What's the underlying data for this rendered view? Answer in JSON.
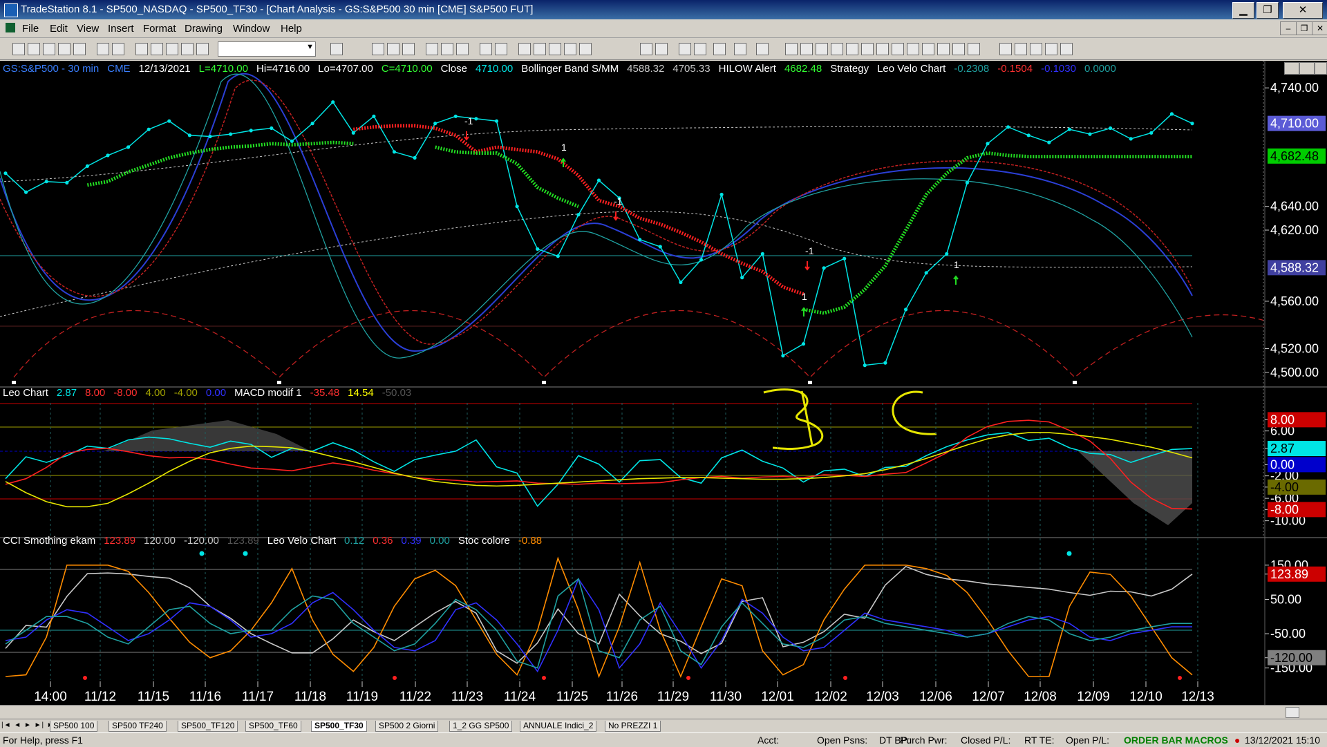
{
  "window": {
    "title": "TradeStation 8.1 - SP500_NASDAQ - SP500_TF30 - [Chart Analysis - GS:S&P500  30 min  [CME] S&P500 FUT]",
    "minimize": "▁",
    "restore": "❐",
    "close": "✕"
  },
  "menu": {
    "items": [
      "File",
      "Edit",
      "View",
      "Insert",
      "Format",
      "Drawing",
      "Window",
      "Help"
    ],
    "mdi": [
      "‒",
      "❐",
      "✕"
    ]
  },
  "header": {
    "segments": [
      {
        "text": "GS:S&P500 - 30 min",
        "color": "#3a7fff"
      },
      {
        "text": "CME",
        "color": "#3a7fff"
      },
      {
        "text": "12/13/2021",
        "color": "#ffffff"
      },
      {
        "text": "L=4710.00",
        "color": "#33ff33"
      },
      {
        "text": "Hi=4716.00",
        "color": "#ffffff"
      },
      {
        "text": "Lo=4707.00",
        "color": "#ffffff"
      },
      {
        "text": "C=4710.00",
        "color": "#33ff33"
      },
      {
        "text": "Close",
        "color": "#ffffff"
      },
      {
        "text": "4710.00",
        "color": "#00e5e5"
      },
      {
        "text": "Bollinger Band S/MM",
        "color": "#ffffff"
      },
      {
        "text": "4588.32",
        "color": "#c8c8c8"
      },
      {
        "text": "4705.33",
        "color": "#c8c8c8"
      },
      {
        "text": "HILOW Alert",
        "color": "#ffffff"
      },
      {
        "text": "4682.48",
        "color": "#33ff33"
      },
      {
        "text": "Strategy",
        "color": "#ffffff"
      },
      {
        "text": "Leo Velo Chart",
        "color": "#ffffff"
      },
      {
        "text": "-0.2308",
        "color": "#1fa0a0"
      },
      {
        "text": "-0.1504",
        "color": "#ff3030"
      },
      {
        "text": "-0.1030",
        "color": "#3030ff"
      },
      {
        "text": "0.0000",
        "color": "#1fa0a0"
      }
    ]
  },
  "panel2_header": {
    "segments": [
      {
        "text": "Leo Chart",
        "color": "#ffffff"
      },
      {
        "text": "2.87",
        "color": "#00e5e5"
      },
      {
        "text": "8.00",
        "color": "#ff3030"
      },
      {
        "text": "-8.00",
        "color": "#ff3030"
      },
      {
        "text": "4.00",
        "color": "#a0a000"
      },
      {
        "text": "-4.00",
        "color": "#a0a000"
      },
      {
        "text": "0.00",
        "color": "#3030ff"
      },
      {
        "text": "MACD modif 1",
        "color": "#ffffff"
      },
      {
        "text": "-35.48",
        "color": "#ff3030"
      },
      {
        "text": "14.54",
        "color": "#ffff00"
      },
      {
        "text": "-50.03",
        "color": "#555555"
      }
    ]
  },
  "panel3_header": {
    "segments": [
      {
        "text": "CCI Smothing ekam",
        "color": "#ffffff"
      },
      {
        "text": "123.89",
        "color": "#ff3030"
      },
      {
        "text": "120.00",
        "color": "#c8c8c8"
      },
      {
        "text": "-120.00",
        "color": "#c8c8c8"
      },
      {
        "text": "123.89",
        "color": "#555555"
      },
      {
        "text": "Leo Velo Chart",
        "color": "#ffffff"
      },
      {
        "text": "0.12",
        "color": "#1fa0a0"
      },
      {
        "text": "0.36",
        "color": "#ff3030"
      },
      {
        "text": "0.39",
        "color": "#3030ff"
      },
      {
        "text": "0.00",
        "color": "#1fa0a0"
      },
      {
        "text": "Stoc colore",
        "color": "#ffffff"
      },
      {
        "text": "-0.88",
        "color": "#ff8c00"
      }
    ]
  },
  "annotations": {
    "hand1": "B",
    "hand2": "C"
  },
  "trade_labels": [
    "-1",
    "1",
    "-1",
    "-1",
    "1",
    "1"
  ],
  "chart_data": [
    {
      "type": "line",
      "title": "GS:S&P500 - 30 min",
      "ylim": [
        4490,
        4750
      ],
      "y_ticks": [
        "4,740.00",
        "4,640.00",
        "4,620.00",
        "4,560.00",
        "4,520.00",
        "4,500.00"
      ],
      "price_tags": [
        {
          "label": "4,710.00",
          "bg": "#5b5bd6",
          "fg": "#ffffff",
          "value": 4710
        },
        {
          "label": "4,682.48",
          "bg": "#00cc00",
          "fg": "#000000",
          "value": 4682.48
        },
        {
          "label": "4,588.32",
          "bg": "#4040a0",
          "fg": "#ffffff",
          "value": 4588.32
        }
      ],
      "x_ticks": [
        "14:00",
        "11/12",
        "11/15",
        "11/16",
        "11/17",
        "11/18",
        "11/19",
        "11/22",
        "11/23",
        "11/24",
        "11/25",
        "11/26",
        "11/29",
        "11/30",
        "12/01",
        "12/02",
        "12/03",
        "12/06",
        "12/07",
        "12/08",
        "12/09",
        "12/10",
        "12/13"
      ],
      "series": [
        {
          "color": "#00e5e5",
          "values": [
            4668,
            4652,
            4661,
            4660,
            4674,
            4683,
            4690,
            4705,
            4712,
            4700,
            4699,
            4701,
            4704,
            4706,
            4695,
            4710,
            4728,
            4702,
            4716,
            4686,
            4681,
            4710,
            4716,
            4714,
            4712,
            4640,
            4604,
            4598,
            4633,
            4662,
            4647,
            4612,
            4606,
            4576,
            4595,
            4650,
            4580,
            4600,
            4514,
            4524,
            4588,
            4596,
            4506,
            4508,
            4553,
            4584,
            4600,
            4660,
            4693,
            4707,
            4700,
            4694,
            4705,
            4701,
            4706,
            4697,
            4702,
            4718,
            4710
          ]
        },
        {
          "color": "#ff2020",
          "values": [
            4693,
            null,
            null,
            null,
            null,
            null,
            null,
            null,
            null,
            null,
            null,
            null,
            null,
            null,
            null,
            null,
            null,
            4705,
            4707,
            4708,
            4708,
            4706,
            4700,
            4686,
            4690,
            4688,
            4686,
            4680,
            4666,
            4645,
            4640,
            4630,
            4625,
            4618,
            4610,
            4600,
            4592,
            4585,
            4572,
            4566,
            null,
            null,
            null,
            null,
            null,
            null,
            null,
            null,
            null,
            null,
            null,
            null,
            null,
            null,
            null,
            null,
            null,
            null,
            null
          ]
        },
        {
          "color": "#22dd22",
          "values": [
            null,
            null,
            null,
            null,
            4658,
            4661,
            4669,
            4675,
            4681,
            4685,
            4688,
            4690,
            4691,
            4693,
            4692,
            4693,
            4694,
            4693,
            null,
            null,
            null,
            4690,
            4686,
            4685,
            4685,
            4676,
            4656,
            4647,
            4640,
            null,
            null,
            null,
            null,
            null,
            null,
            null,
            null,
            null,
            null,
            4553,
            4550,
            4555,
            4570,
            4590,
            4620,
            4650,
            4668,
            4681,
            4685,
            4683,
            4682,
            4682,
            4682,
            4682,
            4682,
            4682,
            4682,
            4682,
            4682
          ]
        }
      ]
    },
    {
      "type": "line",
      "title": "Leo Chart / MACD modif 1",
      "ylim": [
        -13,
        11
      ],
      "y_ticks": [
        "8.00",
        "6.00",
        "2.87",
        "0.00",
        "-2.00",
        "-4.00",
        "-6.00",
        "-8.00",
        "-10.00"
      ],
      "price_tags": [
        {
          "label": "8.00",
          "bg": "#cc0000",
          "fg": "#ffffff",
          "value": 8
        },
        {
          "label": "2.87",
          "bg": "#00e5e5",
          "fg": "#000000",
          "value": 2.87
        },
        {
          "label": "0.00",
          "bg": "#0000cc",
          "fg": "#ffffff",
          "value": 0
        },
        {
          "label": "-4.00",
          "bg": "#6a6a00",
          "fg": "#000000",
          "value": -4
        },
        {
          "label": "-8.00",
          "bg": "#cc0000",
          "fg": "#ffffff",
          "value": -8
        }
      ],
      "series": [
        {
          "color": "#00e5e5",
          "values": [
            -2.5,
            1.4,
            0.4,
            1.6,
            3.3,
            2.9,
            4.4,
            4.9,
            4.6,
            3.8,
            3.1,
            4.2,
            3.6,
            1.3,
            2.9,
            2.4,
            3.9,
            2.6,
            0.5,
            -1.2,
            0.9,
            1.7,
            2.4,
            4.4,
            -0.4,
            -1.5,
            -7.4,
            -3.5,
            1.6,
            0.1,
            -3.1,
            0.7,
            0.9,
            -2.3,
            -3.3,
            1.2,
            2.6,
            0.6,
            -0.6,
            -3.1,
            -1.1,
            -0.8,
            -2.1,
            -0.5,
            -0.3,
            1.6,
            3.2,
            4.4,
            5.3,
            5.7,
            4.3,
            4.7,
            3.0,
            2.0,
            1.8,
            0.4,
            1.6,
            2.7,
            2.87
          ]
        },
        {
          "color": "#ff2020",
          "values": [
            -3.5,
            -2.5,
            -0.5,
            2.0,
            2.7,
            2.9,
            2.3,
            1.6,
            1.2,
            1.3,
            0.9,
            0.1,
            -0.6,
            -0.8,
            -1.1,
            -0.4,
            0.3,
            -0.2,
            -1.0,
            -1.6,
            -2.3,
            -2.6,
            -2.8,
            -3.1,
            -3.0,
            -2.9,
            -3.3,
            -3.4,
            -3.5,
            -3.3,
            -3.4,
            -3.3,
            -3.2,
            -2.7,
            -2.3,
            -2.1,
            -2.4,
            -2.2,
            -2.1,
            -2.3,
            -1.8,
            -1.9,
            -2.1,
            -1.7,
            -1.4,
            0.3,
            2.1,
            4.9,
            6.8,
            7.7,
            7.9,
            7.6,
            6.1,
            4.2,
            1.1,
            -3.1,
            -6.0,
            -7.8,
            -7.9
          ]
        },
        {
          "color": "#e6e600",
          "values": [
            -3.0,
            -5.0,
            -6.6,
            -7.5,
            -7.5,
            -6.9,
            -5.2,
            -3.3,
            -1.2,
            0.6,
            2.1,
            2.9,
            3.3,
            3.2,
            3.0,
            2.3,
            1.4,
            0.5,
            -0.5,
            -1.5,
            -2.3,
            -3.0,
            -3.4,
            -3.7,
            -3.8,
            -3.7,
            -3.5,
            -3.3,
            -3.1,
            -2.9,
            -2.7,
            -2.5,
            -2.4,
            -2.3,
            -2.3,
            -2.4,
            -2.5,
            -2.6,
            -2.6,
            -2.5,
            -2.3,
            -2.0,
            -1.6,
            -0.9,
            0.0,
            1.1,
            2.3,
            3.5,
            4.6,
            5.3,
            5.7,
            5.7,
            5.4,
            5.0,
            4.5,
            3.8,
            3.1,
            2.2,
            1.2
          ]
        }
      ]
    },
    {
      "type": "line",
      "title": "CCI Smothing ekam / Leo Velo Chart / Stoc colore",
      "ylim": [
        -185,
        190
      ],
      "y_ticks": [
        "150.00",
        "123.89",
        "50.00",
        "-50.00",
        "-120.00",
        "-150.00"
      ],
      "price_tags": [
        {
          "label": "123.89",
          "bg": "#cc0000",
          "fg": "#ffffff",
          "value": 123.89
        },
        {
          "label": "-120.00",
          "bg": "#808080",
          "fg": "#000000",
          "value": -120
        }
      ],
      "series": [
        {
          "color": "#c8c8c8",
          "values": [
            -93,
            -26,
            -31,
            59,
            125,
            127,
            124,
            117,
            112,
            84,
            30,
            -5,
            -50,
            -79,
            -106,
            -106,
            -65,
            -10,
            -44,
            -70,
            -30,
            11,
            44,
            10,
            -100,
            -136,
            -77,
            22,
            -50,
            -80,
            65,
            2,
            -50,
            -72,
            -108,
            -78,
            44,
            55,
            -88,
            -75,
            -44,
            7,
            -5,
            92,
            146,
            123,
            110,
            104,
            95,
            90,
            85,
            80,
            70,
            62,
            74,
            72,
            60,
            80,
            123.89
          ]
        },
        {
          "color": "#ff8c00",
          "values": [
            -175,
            -170,
            -60,
            150,
            150,
            150,
            132,
            70,
            -5,
            -75,
            -120,
            -100,
            -40,
            40,
            140,
            -10,
            -110,
            -160,
            -90,
            30,
            110,
            135,
            90,
            -10,
            -110,
            -170,
            -40,
            170,
            20,
            -175,
            -30,
            158,
            -40,
            -175,
            -30,
            110,
            90,
            -100,
            -170,
            -140,
            -10,
            80,
            150,
            150,
            150,
            140,
            120,
            70,
            -10,
            -100,
            -175,
            -175,
            30,
            130,
            123,
            60,
            -30,
            -120,
            -170
          ]
        },
        {
          "color": "#3030ff",
          "values": [
            -70,
            -60,
            -10,
            20,
            10,
            -30,
            -70,
            -50,
            -10,
            40,
            30,
            -10,
            -60,
            -50,
            -20,
            40,
            70,
            20,
            -40,
            -90,
            -100,
            -70,
            20,
            40,
            -10,
            -80,
            -160,
            -40,
            110,
            20,
            -150,
            -80,
            40,
            -50,
            -150,
            -70,
            50,
            10,
            -60,
            -100,
            -90,
            -40,
            10,
            -10,
            -20,
            -30,
            -40,
            -60,
            -50,
            -30,
            -10,
            0,
            -20,
            -60,
            -70,
            -50,
            -40,
            -30,
            -30
          ]
        },
        {
          "color": "#1fa0a0",
          "values": [
            -80,
            -40,
            0,
            0,
            -20,
            -60,
            -80,
            -30,
            20,
            30,
            -20,
            -50,
            -40,
            -40,
            20,
            60,
            50,
            -20,
            -60,
            -100,
            -80,
            -20,
            50,
            20,
            -40,
            -130,
            -150,
            60,
            110,
            -100,
            -120,
            -10,
            30,
            -100,
            -140,
            -30,
            40,
            -20,
            -80,
            -90,
            -60,
            -10,
            0,
            -20,
            -30,
            -40,
            -50,
            -60,
            -50,
            -20,
            0,
            -10,
            -50,
            -70,
            -60,
            -40,
            -30,
            -20,
            -20
          ]
        }
      ]
    }
  ]
}
